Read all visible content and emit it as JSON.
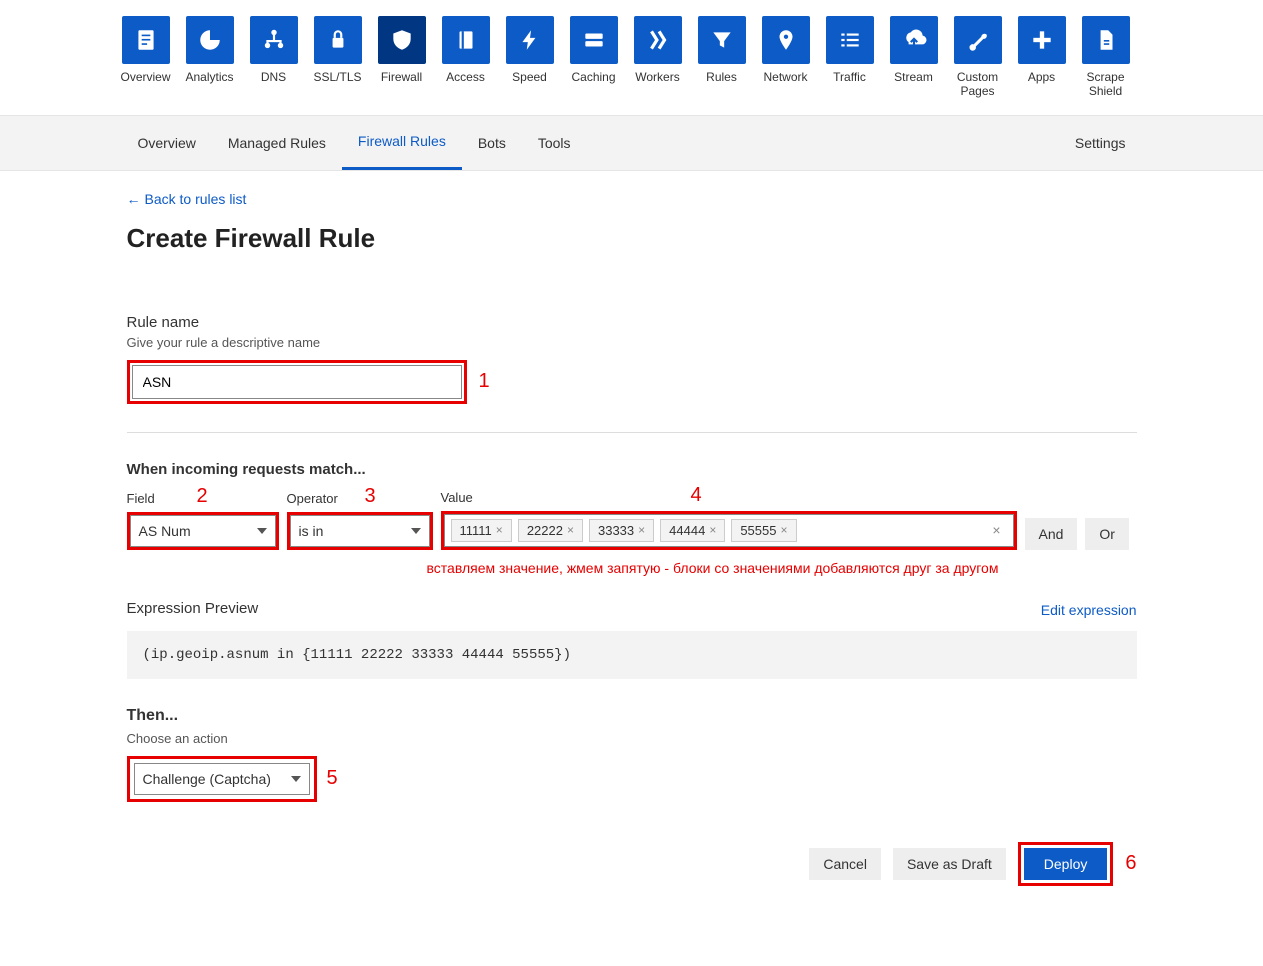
{
  "nav": [
    {
      "label": "Overview"
    },
    {
      "label": "Analytics"
    },
    {
      "label": "DNS"
    },
    {
      "label": "SSL/TLS"
    },
    {
      "label": "Firewall",
      "active": true
    },
    {
      "label": "Access"
    },
    {
      "label": "Speed"
    },
    {
      "label": "Caching"
    },
    {
      "label": "Workers"
    },
    {
      "label": "Rules"
    },
    {
      "label": "Network"
    },
    {
      "label": "Traffic"
    },
    {
      "label": "Stream"
    },
    {
      "label": "Custom\nPages"
    },
    {
      "label": "Apps"
    },
    {
      "label": "Scrape\nShield"
    }
  ],
  "subnav": {
    "tabs": [
      "Overview",
      "Managed Rules",
      "Firewall Rules",
      "Bots",
      "Tools"
    ],
    "active": "Firewall Rules",
    "settings": "Settings"
  },
  "back_link": "Back to rules list",
  "page_title": "Create Firewall Rule",
  "rule_name": {
    "label": "Rule name",
    "hint": "Give your rule a descriptive name",
    "value": "ASN"
  },
  "annotations": {
    "n1": "1",
    "n2": "2",
    "n3": "3",
    "n4": "4",
    "n5": "5",
    "n6": "6"
  },
  "match": {
    "heading": "When incoming requests match...",
    "field_label": "Field",
    "field_value": "AS Num",
    "operator_label": "Operator",
    "operator_value": "is in",
    "value_label": "Value",
    "tags": [
      "11111",
      "22222",
      "33333",
      "44444",
      "55555"
    ],
    "and": "And",
    "or": "Or",
    "hint": "вставляем значение, жмем запятую - блоки со значениями добавляются друг за другом"
  },
  "expr": {
    "label": "Expression Preview",
    "edit": "Edit expression",
    "text": "(ip.geoip.asnum in {11111 22222 33333 44444 55555})"
  },
  "then": {
    "heading": "Then...",
    "hint": "Choose an action",
    "value": "Challenge (Captcha)"
  },
  "footer": {
    "cancel": "Cancel",
    "save": "Save as Draft",
    "deploy": "Deploy"
  }
}
